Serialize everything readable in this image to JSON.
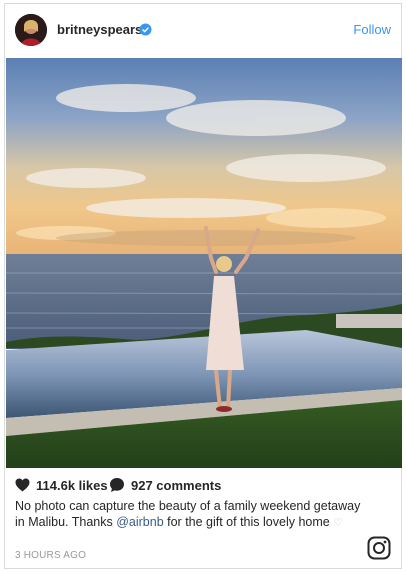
{
  "post": {
    "username": "britneyspears",
    "follow_label": "Follow",
    "likes": "114.6k likes",
    "comments": "927 comments",
    "caption_part1": "No photo can capture the beauty of a family weekend getaway in Malibu. Thanks ",
    "caption_mention": "@airbnb",
    "caption_part2": " for the gift of this lovely home ",
    "timestamp": "3 HOURS AGO"
  },
  "icons": {
    "verified": "verified-badge-icon",
    "like": "heart-icon",
    "comment": "comment-bubble-icon",
    "platform": "instagram-logo-icon"
  },
  "colors": {
    "link_blue": "#3897f0",
    "mention": "#3b5b85",
    "text": "#262626",
    "muted": "#999999"
  }
}
